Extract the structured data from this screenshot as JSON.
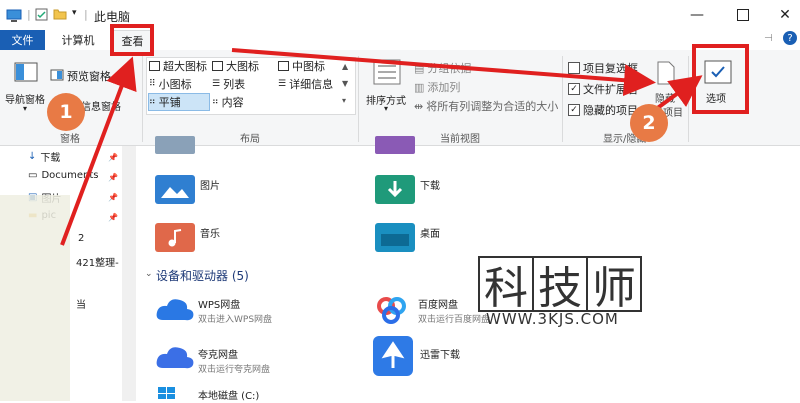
{
  "window": {
    "title": "此电脑",
    "help_glyph": "?"
  },
  "tabs": {
    "file": "文件",
    "computer": "计算机",
    "view": "查看"
  },
  "ribbon": {
    "panes": {
      "nav_pane": "导航窗格",
      "preview_pane": "预览窗格",
      "details_pane": "细信息窗格",
      "group_label": "窗格"
    },
    "layout": {
      "options": [
        "超大图标",
        "大图标",
        "中图标",
        "小图标",
        "列表",
        "详细信息",
        "平铺",
        "内容"
      ],
      "group_label": "布局"
    },
    "current_view": {
      "sort": "排序方式",
      "group_by": "分组依据",
      "add_column": "添加列",
      "fit_columns": "将所有列调整为合适的大小",
      "group_label": "当前视图"
    },
    "show_hide": {
      "item_checkbox": "项目复选框",
      "file_ext": "文件扩展名",
      "hidden_items": "隐藏的项目",
      "hide": "隐藏",
      "selected_items": "所选项目",
      "group_label": "显示/隐藏",
      "item_checkbox_checked": false,
      "file_ext_checked": true,
      "hidden_items_checked": true
    },
    "options": {
      "label": "选项"
    }
  },
  "sidebar": {
    "items": [
      {
        "label": "下载",
        "icon": "download-icon"
      },
      {
        "label": "Documents",
        "icon": "documents-icon"
      },
      {
        "label": "图片",
        "icon": "pictures-icon"
      },
      {
        "label": "pic",
        "icon": "folder-icon"
      }
    ],
    "partial": [
      "2",
      "421整理-",
      "当"
    ]
  },
  "content": {
    "folders": [
      {
        "label": "图片",
        "icon": "pictures-folder-icon",
        "color": "#2f7fd1"
      },
      {
        "label": "下载",
        "icon": "downloads-folder-icon",
        "color": "#1f9a7a"
      },
      {
        "label": "音乐",
        "icon": "music-folder-icon",
        "color": "#e0684a"
      },
      {
        "label": "桌面",
        "icon": "desktop-folder-icon",
        "color": "#1a8fc0"
      }
    ],
    "section_title": "设备和驱动器 (5)",
    "devices": [
      {
        "name": "WPS网盘",
        "sub": "双击进入WPS网盘"
      },
      {
        "name": "百度网盘",
        "sub": "双击运行百度网盘"
      },
      {
        "name": "夸克网盘",
        "sub": "双击运行夸克网盘"
      },
      {
        "name": "迅雷下载",
        "sub": ""
      },
      {
        "name": "本地磁盘 (C:)",
        "sub": ""
      }
    ]
  },
  "annotations": {
    "step1": "1",
    "step2": "2"
  },
  "watermark": {
    "chars": [
      "科",
      "技",
      "师"
    ],
    "url": "WWW.3KJS.COM"
  },
  "colors": {
    "accent": "#1a5fb4",
    "highlight_red": "#e0201f",
    "step_circle": "#e87a45"
  }
}
